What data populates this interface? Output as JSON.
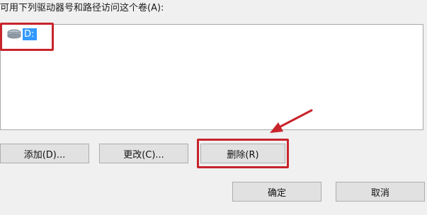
{
  "dialog": {
    "instruction": "可用下列驱动器号和路径访问这个卷(A):",
    "paths": [
      {
        "label": "D:"
      }
    ],
    "buttons": {
      "add": "添加(D)...",
      "change": "更改(C)...",
      "remove": "删除(R)",
      "ok": "确定",
      "cancel": "取消"
    }
  },
  "annotation": {
    "highlight_color": "#c8242b",
    "selection_color": "#3399ff"
  }
}
